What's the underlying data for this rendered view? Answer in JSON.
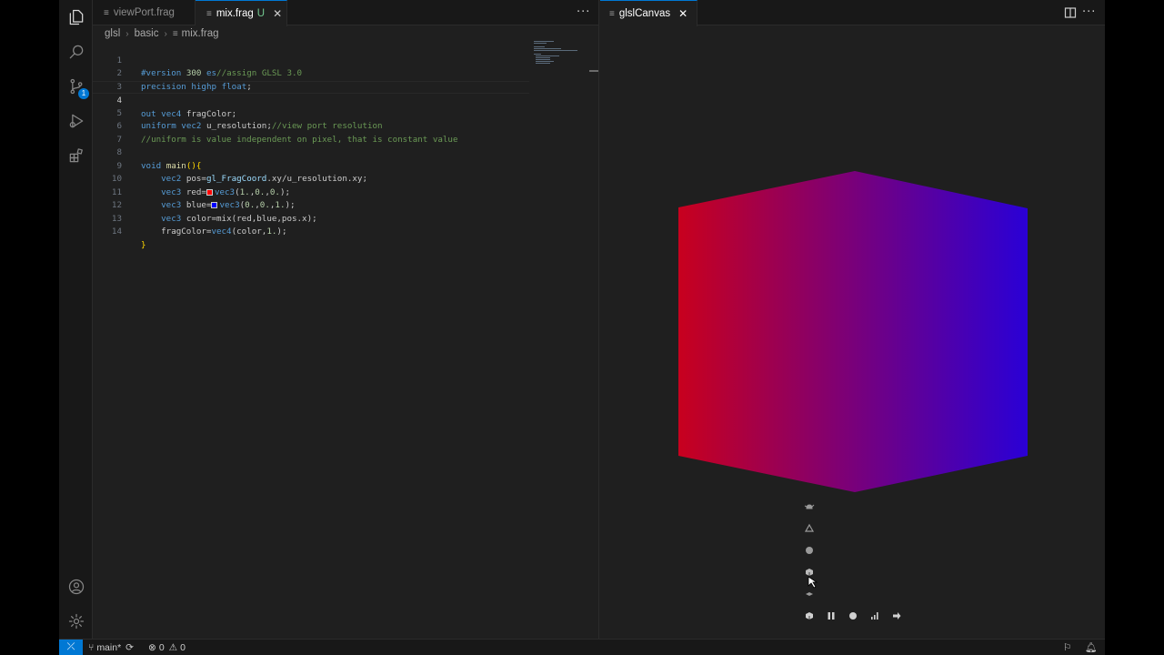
{
  "activity_bar": {
    "items": [
      "explorer-icon",
      "search-icon",
      "source-control-icon",
      "run-debug-icon",
      "extensions-icon"
    ],
    "source_control_badge": "1",
    "bottom": [
      "account-icon",
      "settings-icon"
    ]
  },
  "editor": {
    "tabs": [
      {
        "label": "viewPort.frag",
        "modified": "",
        "active": false
      },
      {
        "label": "mix.frag",
        "modified": "U",
        "active": true
      }
    ],
    "tab_close": "✕",
    "more": "···",
    "breadcrumb": [
      "glsl",
      "basic",
      "mix.frag"
    ],
    "current_line": 4,
    "lines": [
      {
        "n": "1",
        "t": "#version 300 es//assign GLSL 3.0"
      },
      {
        "n": "2",
        "t": "precision highp float;"
      },
      {
        "n": "3",
        "t": ""
      },
      {
        "n": "4",
        "t": "out vec4 fragColor;"
      },
      {
        "n": "5",
        "t": "uniform vec2 u_resolution;//view port resolution"
      },
      {
        "n": "6",
        "t": "//uniform is value independent on pixel, that is constant value"
      },
      {
        "n": "7",
        "t": ""
      },
      {
        "n": "8",
        "t": "void main(){"
      },
      {
        "n": "9",
        "t": "    vec2 pos=gl_FragCoord.xy/u_resolution.xy;"
      },
      {
        "n": "10",
        "t": "    vec3 red=vec3(1.,0.,0.);"
      },
      {
        "n": "11",
        "t": "    vec3 blue=vec3(0.,0.,1.);"
      },
      {
        "n": "12",
        "t": "    vec3 color=mix(red,blue,pos.x);"
      },
      {
        "n": "13",
        "t": "    fragColor=vec4(color,1.);"
      },
      {
        "n": "14",
        "t": "}"
      }
    ],
    "colors": {
      "red_swatch": "#ff0000",
      "blue_swatch": "#0000ff"
    }
  },
  "preview": {
    "tab_label": "glslCanvas",
    "tab_close": "✕",
    "more": "···",
    "shape_colors": {
      "left": "#c8001e",
      "right": "#2a00d6"
    },
    "shape_icons": [
      "teapot-icon",
      "tetrahedron-icon",
      "sphere-icon",
      "cube-icon",
      "plane-icon"
    ],
    "playback_icons": [
      "cube-icon",
      "pause-icon",
      "record-icon",
      "stats-icon",
      "arrow-right-icon"
    ]
  },
  "status_bar": {
    "remote_icon": "remote-icon",
    "branch": "main*",
    "errors": "0",
    "warnings": "0"
  }
}
